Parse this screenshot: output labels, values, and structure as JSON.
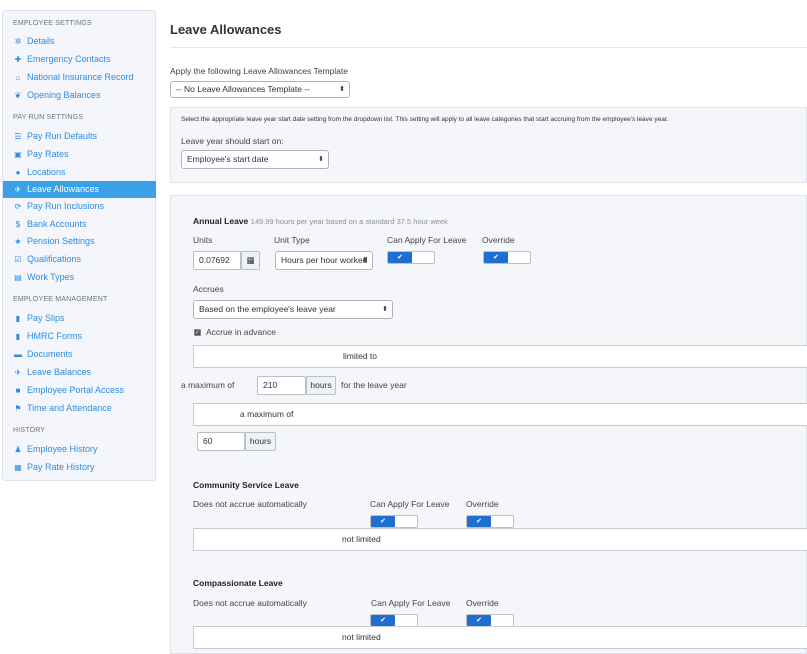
{
  "sidebar": {
    "sections": {
      "employee_settings": "EMPLOYEE SETTINGS",
      "pay_run_settings": "PAY RUN SETTINGS",
      "employee_management": "EMPLOYEE MANAGEMENT",
      "history": "HISTORY"
    },
    "items": {
      "details": "Details",
      "emergency_contacts": "Emergency Contacts",
      "national_insurance_record": "National Insurance Record",
      "opening_balances": "Opening Balances",
      "pay_run_defaults": "Pay Run Defaults",
      "pay_rates": "Pay Rates",
      "locations": "Locations",
      "leave_allowances": "Leave Allowances",
      "pay_run_inclusions": "Pay Run Inclusions",
      "bank_accounts": "Bank Accounts",
      "pension_settings": "Pension Settings",
      "qualifications": "Qualifications",
      "work_types": "Work Types",
      "pay_slips": "Pay Slips",
      "hmrc_forms": "HMRC Forms",
      "documents": "Documents",
      "leave_balances": "Leave Balances",
      "employee_portal_access": "Employee Portal Access",
      "time_and_attendance": "Time and Attendance",
      "employee_history": "Employee History",
      "pay_rate_history": "Pay Rate History"
    },
    "active": "leave_allowances",
    "accent_color": "#3aa0e8",
    "link_color": "#2e8ce0"
  },
  "main": {
    "title": "Leave Allowances",
    "template": {
      "label": "Apply the following Leave Allowances Template",
      "selected": "-- No Leave Allowances Template --"
    },
    "leave_year": {
      "note": "Select the appropriate leave year start date setting from the dropdown list. This setting will apply to all leave categories that start accruing from the employee's leave year.",
      "label": "Leave year should start on:",
      "selected": "Employee's start date"
    },
    "annual_leave": {
      "title": "Annual Leave",
      "subtitle": "149.99 hours per year based on a standard 37.5 hour week",
      "units_label": "Units",
      "units_value": "0.07692",
      "unit_type_label": "Unit Type",
      "unit_type_selected": "Hours per hour worked",
      "can_apply_label": "Can Apply For Leave",
      "override_label": "Override",
      "accrues_label": "Accrues",
      "accrues_selected": "Based on the employee's leave year",
      "accrue_in_advance_label": "Accrue in advance",
      "limit_box_text": "limited to",
      "maximum_prefix": "a maximum of",
      "maximum_value": "210",
      "maximum_unit": "hours",
      "maximum_suffix": "for the leave year",
      "carry_box_text": "a maximum of",
      "carry_value": "60",
      "carry_unit": "hours"
    },
    "community_service_leave": {
      "title": "Community Service Leave",
      "accrual_text": "Does not accrue automatically",
      "can_apply_label": "Can Apply For Leave",
      "override_label": "Override",
      "limit_box_text": "not limited"
    },
    "compassionate_leave": {
      "title": "Compassionate Leave",
      "accrual_text": "Does not accrue automatically",
      "can_apply_label": "Can Apply For Leave",
      "override_label": "Override",
      "limit_box_text": "not limited"
    },
    "toggle_color": "#1f6fd1",
    "toggle_check": "✔"
  }
}
